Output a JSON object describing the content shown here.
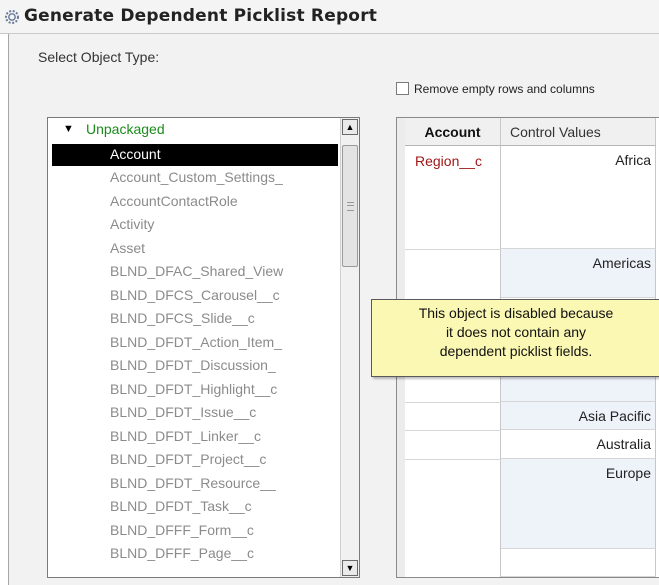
{
  "window": {
    "title": "Generate Dependent Picklist Report"
  },
  "form": {
    "select_object_label": "Select Object Type:",
    "remove_empty_label": "Remove empty rows and columns",
    "remove_empty_checked": false
  },
  "tree": {
    "root_label": "Unpackaged",
    "items": [
      {
        "label": "Account",
        "selected": true
      },
      {
        "label": "Account_Custom_Settings_"
      },
      {
        "label": "AccountContactRole"
      },
      {
        "label": "Activity"
      },
      {
        "label": "Asset"
      },
      {
        "label": "BLND_DFAC_Shared_View"
      },
      {
        "label": "BLND_DFCS_Carousel__c"
      },
      {
        "label": "BLND_DFCS_Slide__c"
      },
      {
        "label": "BLND_DFDT_Action_Item_"
      },
      {
        "label": "BLND_DFDT_Discussion_"
      },
      {
        "label": "BLND_DFDT_Highlight__c"
      },
      {
        "label": "BLND_DFDT_Issue__c"
      },
      {
        "label": "BLND_DFDT_Linker__c"
      },
      {
        "label": "BLND_DFDT_Project__c"
      },
      {
        "label": "BLND_DFDT_Resource__"
      },
      {
        "label": "BLND_DFDT_Task__c"
      },
      {
        "label": "BLND_DFFF_Form__c"
      },
      {
        "label": "BLND_DFFF_Page__c"
      }
    ]
  },
  "report": {
    "headers": {
      "object": "Account",
      "control": "Control Values"
    },
    "field_name": "Region__c",
    "values": [
      {
        "label": "Africa"
      },
      {
        "label": "Americas"
      },
      {
        "label": ""
      },
      {
        "label": ""
      },
      {
        "label": ""
      },
      {
        "label": "Asia Pacific"
      },
      {
        "label": "Australia"
      },
      {
        "label": "Europe"
      },
      {
        "label": ""
      }
    ]
  },
  "tooltip": {
    "line1": "This object is disabled because",
    "line2": "it does not contain any",
    "line3": "dependent picklist fields."
  },
  "colors": {
    "root_node": "#1a8c1a",
    "field_name": "#a01818",
    "tooltip_bg": "#fbf8b3",
    "selection_bg": "#000000"
  }
}
